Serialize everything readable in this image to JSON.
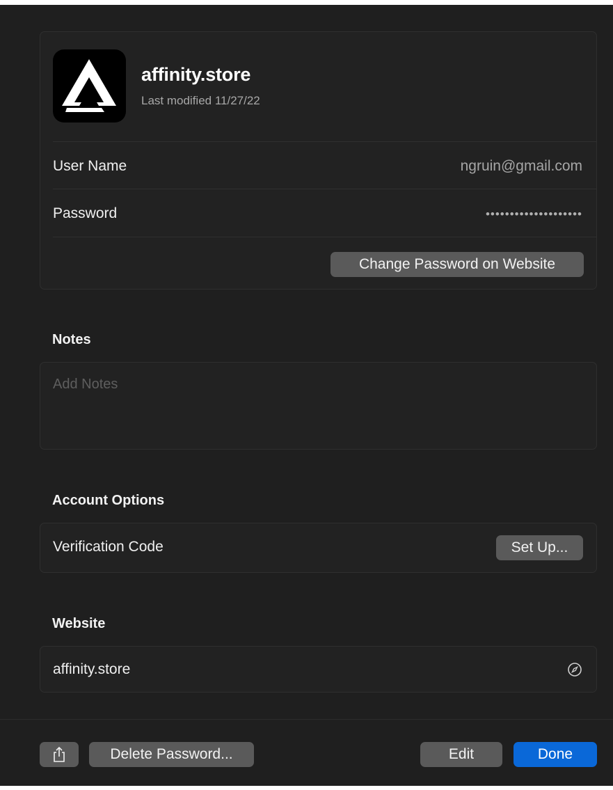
{
  "entry": {
    "title": "affinity.store",
    "last_modified": "Last modified 11/27/22",
    "icon": "affinity-logo-icon"
  },
  "fields": {
    "username_label": "User Name",
    "username_value": "ngruin@gmail.com",
    "password_label": "Password",
    "password_value": "••••••••••••••••••••",
    "change_password_button": "Change Password on Website"
  },
  "notes": {
    "title": "Notes",
    "placeholder": "Add Notes",
    "value": ""
  },
  "account_options": {
    "title": "Account Options",
    "verification_label": "Verification Code",
    "setup_button": "Set Up..."
  },
  "website": {
    "title": "Website",
    "url": "affinity.store",
    "icon": "compass-icon"
  },
  "footer": {
    "share_icon": "share-icon",
    "delete_button": "Delete Password...",
    "edit_button": "Edit",
    "done_button": "Done"
  },
  "colors": {
    "background": "#1f1f1f",
    "card": "#222222",
    "button": "#5a5a5a",
    "accent": "#0a68d8"
  }
}
